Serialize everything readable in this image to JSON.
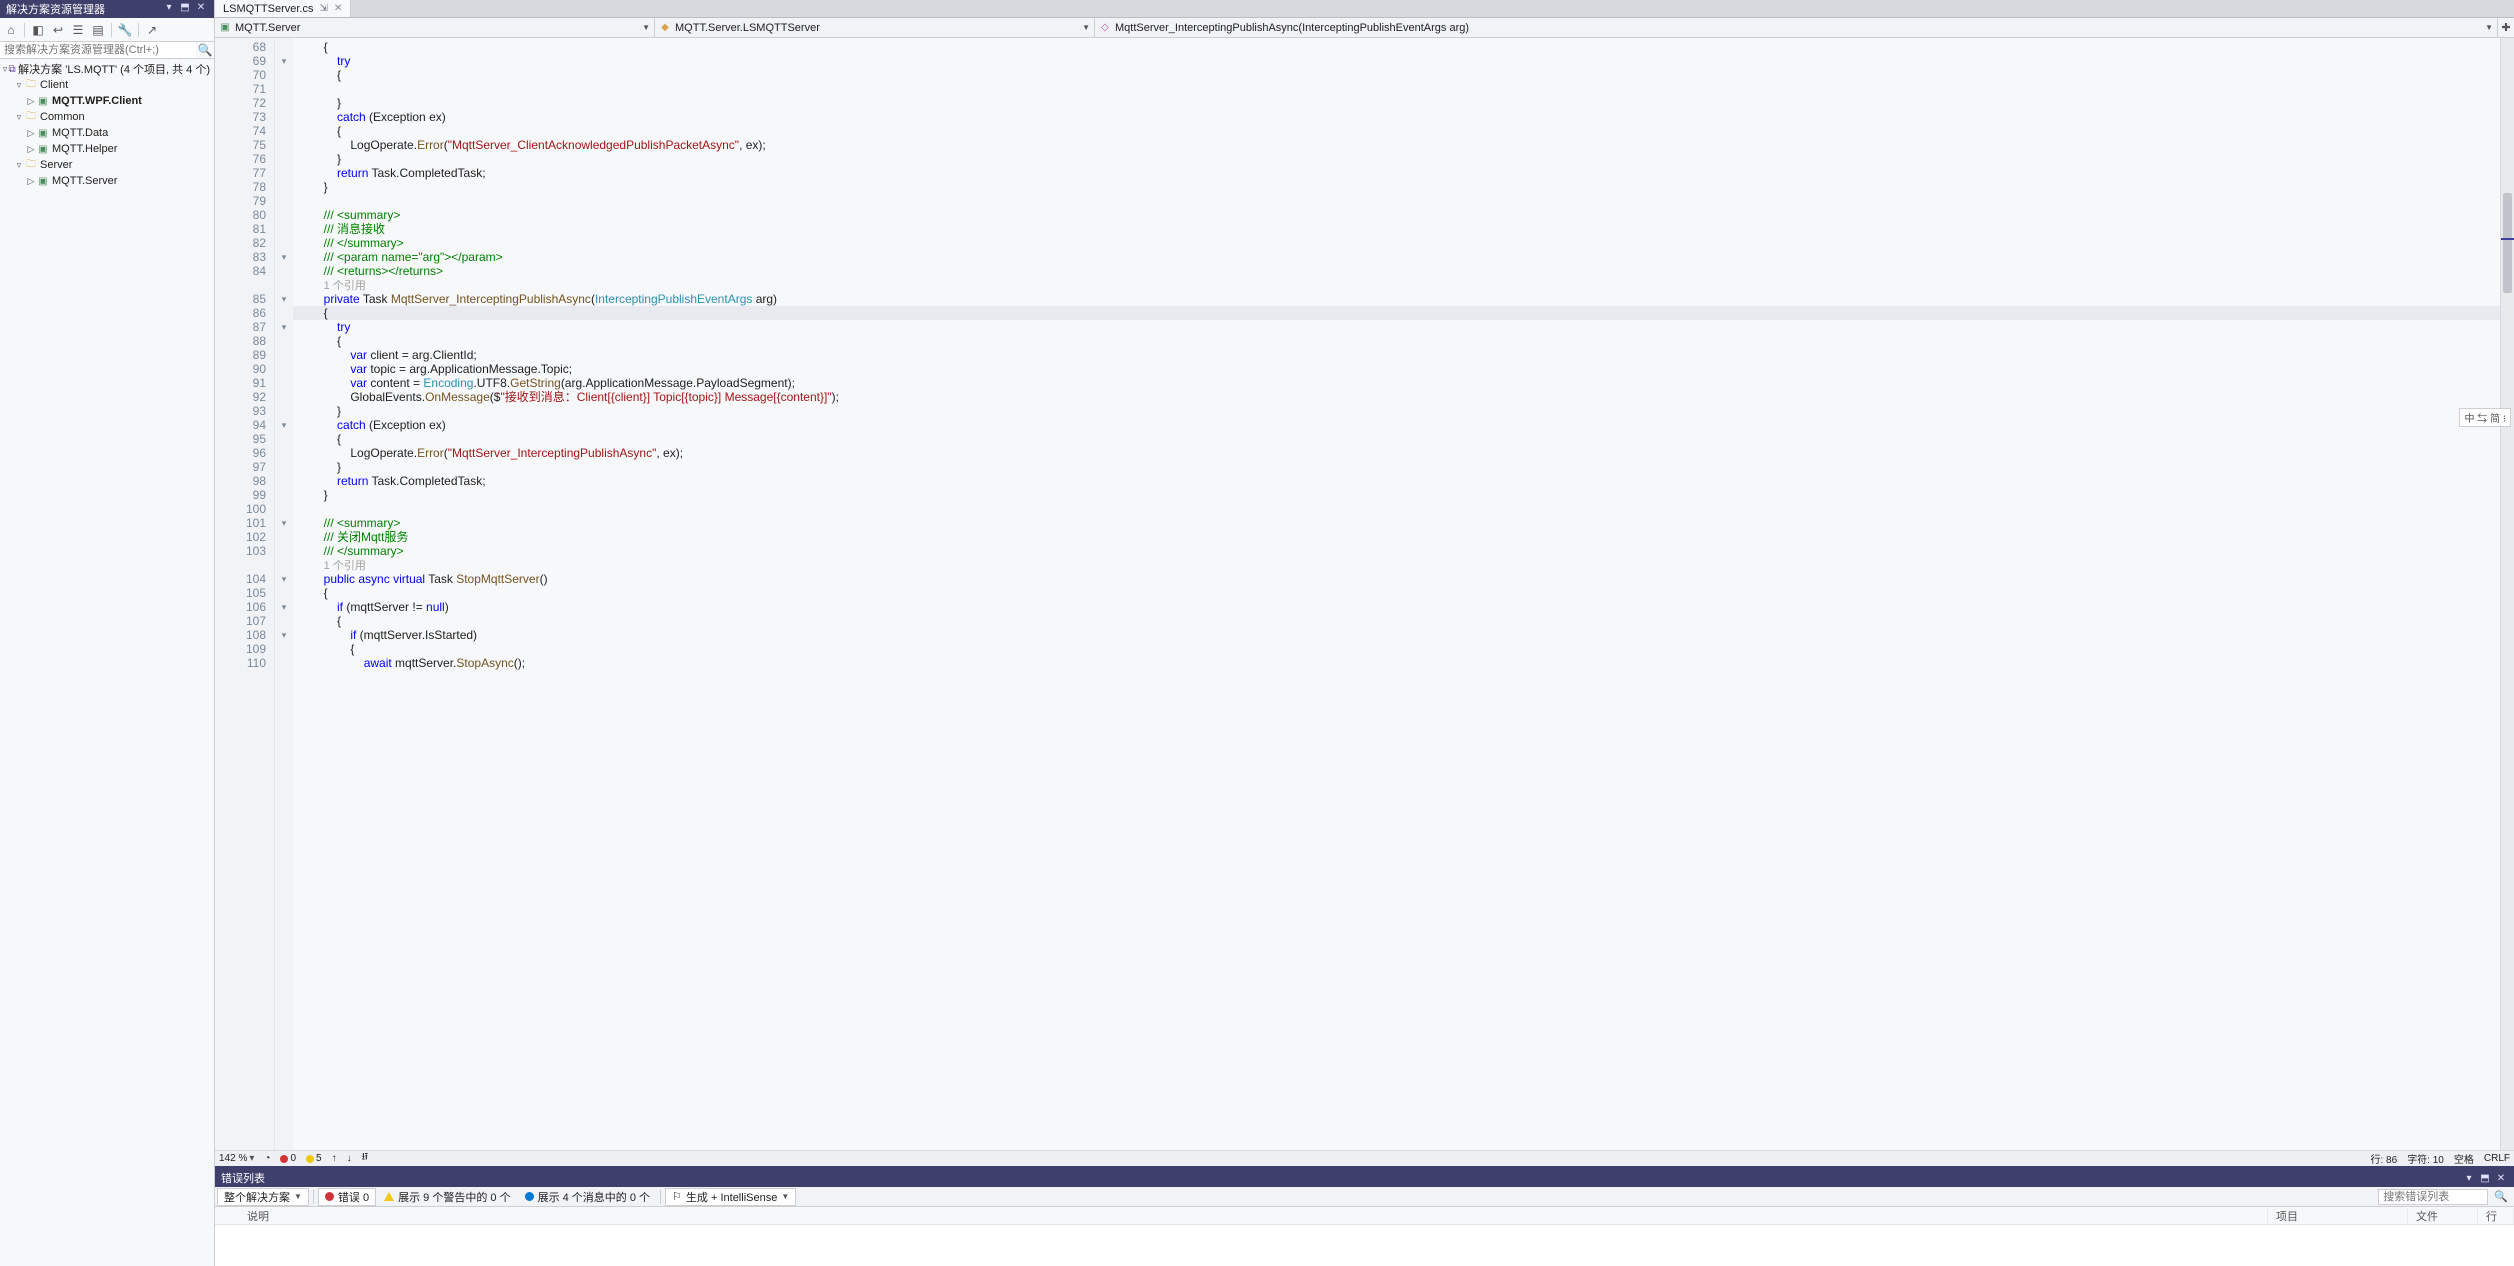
{
  "solution_explorer": {
    "title": "解决方案资源管理器",
    "search_placeholder": "搜索解决方案资源管理器(Ctrl+;)",
    "root_label": "解决方案 'LS.MQTT' (4 个项目, 共 4 个)",
    "nodes": [
      {
        "label": "Client",
        "kind": "folder",
        "indent": 1,
        "expander": "▿"
      },
      {
        "label": "MQTT.WPF.Client",
        "kind": "project",
        "indent": 2,
        "bold": true,
        "expander": "▷"
      },
      {
        "label": "Common",
        "kind": "folder",
        "indent": 1,
        "expander": "▿"
      },
      {
        "label": "MQTT.Data",
        "kind": "project",
        "indent": 2,
        "expander": "▷"
      },
      {
        "label": "MQTT.Helper",
        "kind": "project",
        "indent": 2,
        "expander": "▷"
      },
      {
        "label": "Server",
        "kind": "folder",
        "indent": 1,
        "expander": "▿"
      },
      {
        "label": "MQTT.Server",
        "kind": "project",
        "indent": 2,
        "expander": "▷"
      }
    ]
  },
  "tabs": {
    "active": {
      "label": "LSMQTTServer.cs"
    }
  },
  "navbar": {
    "project": "MQTT.Server",
    "type": "MQTT.Server.LSMQTTServer",
    "member": "MqttServer_InterceptingPublishAsync(InterceptingPublishEventArgs arg)"
  },
  "editor": {
    "first_line": 68,
    "ref_label": "1 个引用",
    "fold_marks": {
      "69": "▾",
      "83": "▾",
      "85": "▾",
      "87": "▾",
      "94": "▾",
      "101": "▾",
      "104": "▾",
      "106": "▾",
      "108": "▾"
    },
    "lines": [
      {
        "n": 68,
        "tokens": [
          [
            "p",
            "        {"
          ]
        ]
      },
      {
        "n": 69,
        "tokens": [
          [
            "p",
            "            "
          ],
          [
            "kw",
            "try"
          ]
        ]
      },
      {
        "n": 70,
        "tokens": [
          [
            "p",
            "            {"
          ]
        ]
      },
      {
        "n": 71,
        "tokens": [
          [
            "p",
            ""
          ]
        ]
      },
      {
        "n": 72,
        "tokens": [
          [
            "p",
            "            }"
          ]
        ]
      },
      {
        "n": 73,
        "tokens": [
          [
            "p",
            "            "
          ],
          [
            "kw",
            "catch"
          ],
          [
            "p",
            " (Exception ex)"
          ]
        ]
      },
      {
        "n": 74,
        "tokens": [
          [
            "p",
            "            {"
          ]
        ]
      },
      {
        "n": 75,
        "tokens": [
          [
            "p",
            "                LogOperate."
          ],
          [
            "mth",
            "Error"
          ],
          [
            "p",
            "("
          ],
          [
            "str",
            "\"MqttServer_ClientAcknowledgedPublishPacketAsync\""
          ],
          [
            "p",
            ", ex);"
          ]
        ]
      },
      {
        "n": 76,
        "tokens": [
          [
            "p",
            "            }"
          ]
        ]
      },
      {
        "n": 77,
        "tokens": [
          [
            "p",
            "            "
          ],
          [
            "kw",
            "return"
          ],
          [
            "p",
            " Task.CompletedTask;"
          ]
        ]
      },
      {
        "n": 78,
        "tokens": [
          [
            "p",
            "        }"
          ]
        ]
      },
      {
        "n": 79,
        "tokens": [
          [
            "p",
            ""
          ]
        ]
      },
      {
        "n": 80,
        "tokens": [
          [
            "p",
            "        "
          ],
          [
            "cm",
            "/// <summary>"
          ]
        ]
      },
      {
        "n": 81,
        "tokens": [
          [
            "p",
            "        "
          ],
          [
            "cm",
            "/// 消息接收"
          ]
        ]
      },
      {
        "n": 82,
        "tokens": [
          [
            "p",
            "        "
          ],
          [
            "cm",
            "/// </summary>"
          ]
        ]
      },
      {
        "n": 83,
        "tokens": [
          [
            "p",
            "        "
          ],
          [
            "cm",
            "/// <param name=\"arg\"></param>"
          ]
        ]
      },
      {
        "n": 84,
        "tokens": [
          [
            "p",
            "        "
          ],
          [
            "cm",
            "/// <returns></returns>"
          ]
        ]
      },
      {
        "n": -1,
        "tokens": [
          [
            "p",
            "        "
          ],
          [
            "ref",
            "1 个引用"
          ]
        ]
      },
      {
        "n": 85,
        "tokens": [
          [
            "p",
            "        "
          ],
          [
            "kw",
            "private"
          ],
          [
            "p",
            " Task "
          ],
          [
            "mth",
            "MqttServer_InterceptingPublishAsync"
          ],
          [
            "p",
            "("
          ],
          [
            "typ",
            "InterceptingPublishEventArgs"
          ],
          [
            "p",
            " arg)"
          ]
        ]
      },
      {
        "n": 86,
        "hl": true,
        "tokens": [
          [
            "p",
            "        {"
          ]
        ]
      },
      {
        "n": 87,
        "tokens": [
          [
            "p",
            "            "
          ],
          [
            "kw",
            "try"
          ]
        ]
      },
      {
        "n": 88,
        "tokens": [
          [
            "p",
            "            {"
          ]
        ]
      },
      {
        "n": 89,
        "tokens": [
          [
            "p",
            "                "
          ],
          [
            "kw",
            "var"
          ],
          [
            "p",
            " client = arg.ClientId;"
          ]
        ]
      },
      {
        "n": 90,
        "tokens": [
          [
            "p",
            "                "
          ],
          [
            "kw",
            "var"
          ],
          [
            "p",
            " topic = arg.ApplicationMessage.Topic;"
          ]
        ]
      },
      {
        "n": 91,
        "tokens": [
          [
            "p",
            "                "
          ],
          [
            "kw",
            "var"
          ],
          [
            "p",
            " content = "
          ],
          [
            "typ",
            "Encoding"
          ],
          [
            "p",
            ".UTF8."
          ],
          [
            "mth",
            "GetString"
          ],
          [
            "p",
            "(arg.ApplicationMessage.PayloadSegment);"
          ]
        ]
      },
      {
        "n": 92,
        "tokens": [
          [
            "p",
            "                GlobalEvents."
          ],
          [
            "mth",
            "OnMessage"
          ],
          [
            "p",
            "($"
          ],
          [
            "str",
            "\"接收到消息：Client[{client}] Topic[{topic}] Message[{content}]\""
          ],
          [
            "p",
            ");"
          ]
        ]
      },
      {
        "n": 93,
        "tokens": [
          [
            "p",
            "            }"
          ]
        ]
      },
      {
        "n": 94,
        "tokens": [
          [
            "p",
            "            "
          ],
          [
            "kw",
            "catch"
          ],
          [
            "p",
            " (Exception ex)"
          ]
        ]
      },
      {
        "n": 95,
        "tokens": [
          [
            "p",
            "            {"
          ]
        ]
      },
      {
        "n": 96,
        "tokens": [
          [
            "p",
            "                LogOperate."
          ],
          [
            "mth",
            "Error"
          ],
          [
            "p",
            "("
          ],
          [
            "str",
            "\"MqttServer_InterceptingPublishAsync\""
          ],
          [
            "p",
            ", ex);"
          ]
        ]
      },
      {
        "n": 97,
        "tokens": [
          [
            "p",
            "            }"
          ]
        ]
      },
      {
        "n": 98,
        "tokens": [
          [
            "p",
            "            "
          ],
          [
            "kw",
            "return"
          ],
          [
            "p",
            " Task.CompletedTask;"
          ]
        ]
      },
      {
        "n": 99,
        "tokens": [
          [
            "p",
            "        }"
          ]
        ]
      },
      {
        "n": 100,
        "tokens": [
          [
            "p",
            ""
          ]
        ]
      },
      {
        "n": 101,
        "tokens": [
          [
            "p",
            "        "
          ],
          [
            "cm",
            "/// <summary>"
          ]
        ]
      },
      {
        "n": 102,
        "tokens": [
          [
            "p",
            "        "
          ],
          [
            "cm",
            "/// 关闭Mqtt服务"
          ]
        ]
      },
      {
        "n": 103,
        "tokens": [
          [
            "p",
            "        "
          ],
          [
            "cm",
            "/// </summary>"
          ]
        ]
      },
      {
        "n": -1,
        "tokens": [
          [
            "p",
            "        "
          ],
          [
            "ref",
            "1 个引用"
          ]
        ]
      },
      {
        "n": 104,
        "tokens": [
          [
            "p",
            "        "
          ],
          [
            "kw",
            "public"
          ],
          [
            "p",
            " "
          ],
          [
            "kw",
            "async"
          ],
          [
            "p",
            " "
          ],
          [
            "kw",
            "virtual"
          ],
          [
            "p",
            " Task "
          ],
          [
            "mth",
            "StopMqttServer"
          ],
          [
            "p",
            "()"
          ]
        ]
      },
      {
        "n": 105,
        "tokens": [
          [
            "p",
            "        {"
          ]
        ]
      },
      {
        "n": 106,
        "tokens": [
          [
            "p",
            "            "
          ],
          [
            "kw",
            "if"
          ],
          [
            "p",
            " (mqttServer != "
          ],
          [
            "kw",
            "null"
          ],
          [
            "p",
            ")"
          ]
        ]
      },
      {
        "n": 107,
        "tokens": [
          [
            "p",
            "            {"
          ]
        ]
      },
      {
        "n": 108,
        "tokens": [
          [
            "p",
            "                "
          ],
          [
            "kw",
            "if"
          ],
          [
            "p",
            " (mqttServer.IsStarted)"
          ]
        ]
      },
      {
        "n": 109,
        "tokens": [
          [
            "p",
            "                {"
          ]
        ]
      },
      {
        "n": 110,
        "tokens": [
          [
            "p",
            "                    "
          ],
          [
            "kw",
            "await"
          ],
          [
            "p",
            " mqttServer."
          ],
          [
            "mth",
            "StopAsync"
          ],
          [
            "p",
            "();"
          ]
        ]
      }
    ],
    "ime_badge": "中 ⇆ 简 ⁝"
  },
  "editor_status": {
    "zoom": "142 %",
    "errors": "0",
    "warnings": "5",
    "line_label": "行: 86",
    "col_label": "字符: 10",
    "ins_label": "空格",
    "eol_label": "CRLF"
  },
  "error_list": {
    "title": "错误列表",
    "scope": "整个解决方案",
    "err_label": "错误 0",
    "warn_label": "展示 9 个警告中的 0 个",
    "msg_label": "展示 4 个消息中的 0 个",
    "build_label": "生成 + IntelliSense",
    "search_placeholder": "搜索错误列表",
    "columns": {
      "desc": "说明",
      "project": "项目",
      "file": "文件",
      "line": "行"
    }
  }
}
